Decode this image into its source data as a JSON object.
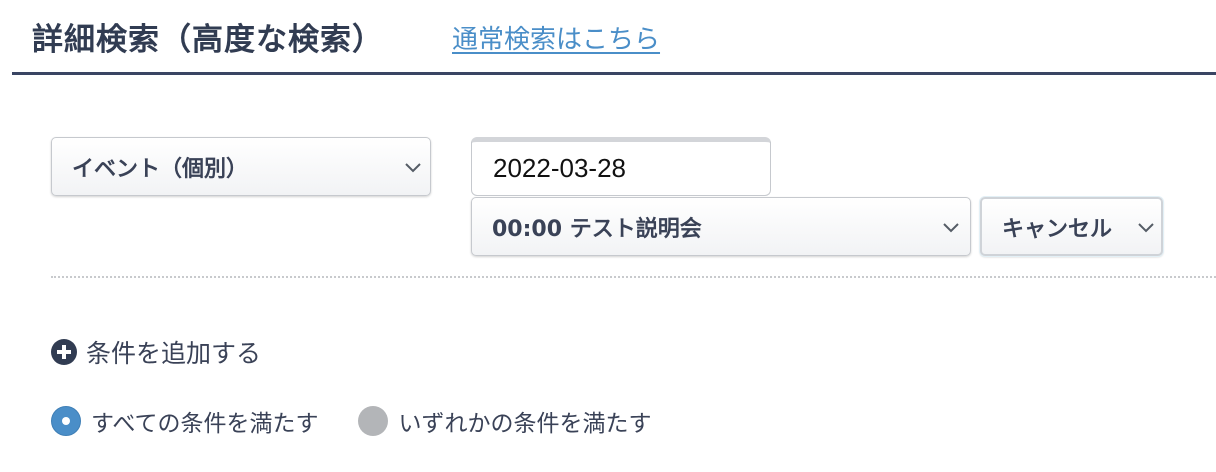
{
  "header": {
    "title": "詳細検索（高度な検索）",
    "normal_search_link": "通常検索はこちら"
  },
  "condition": {
    "target_select": {
      "selected": "イベント（個別）"
    },
    "date_input": {
      "value": "2022-03-28"
    },
    "event_select": {
      "selected": "00:00 テスト説明会"
    },
    "status_select": {
      "selected": "キャンセル"
    }
  },
  "add_condition": {
    "label": "条件を追加する",
    "icon": "plus-circle-icon"
  },
  "match_mode": {
    "options": [
      {
        "label": "すべての条件を満たす",
        "checked": true
      },
      {
        "label": "いずれかの条件を満たす",
        "checked": false
      }
    ]
  },
  "colors": {
    "title": "#313c52",
    "link": "#4a8ec8",
    "header_rule": "#3a4563",
    "radio_checked": "#4a8ec8",
    "radio_unchecked": "#b3b5b8"
  }
}
